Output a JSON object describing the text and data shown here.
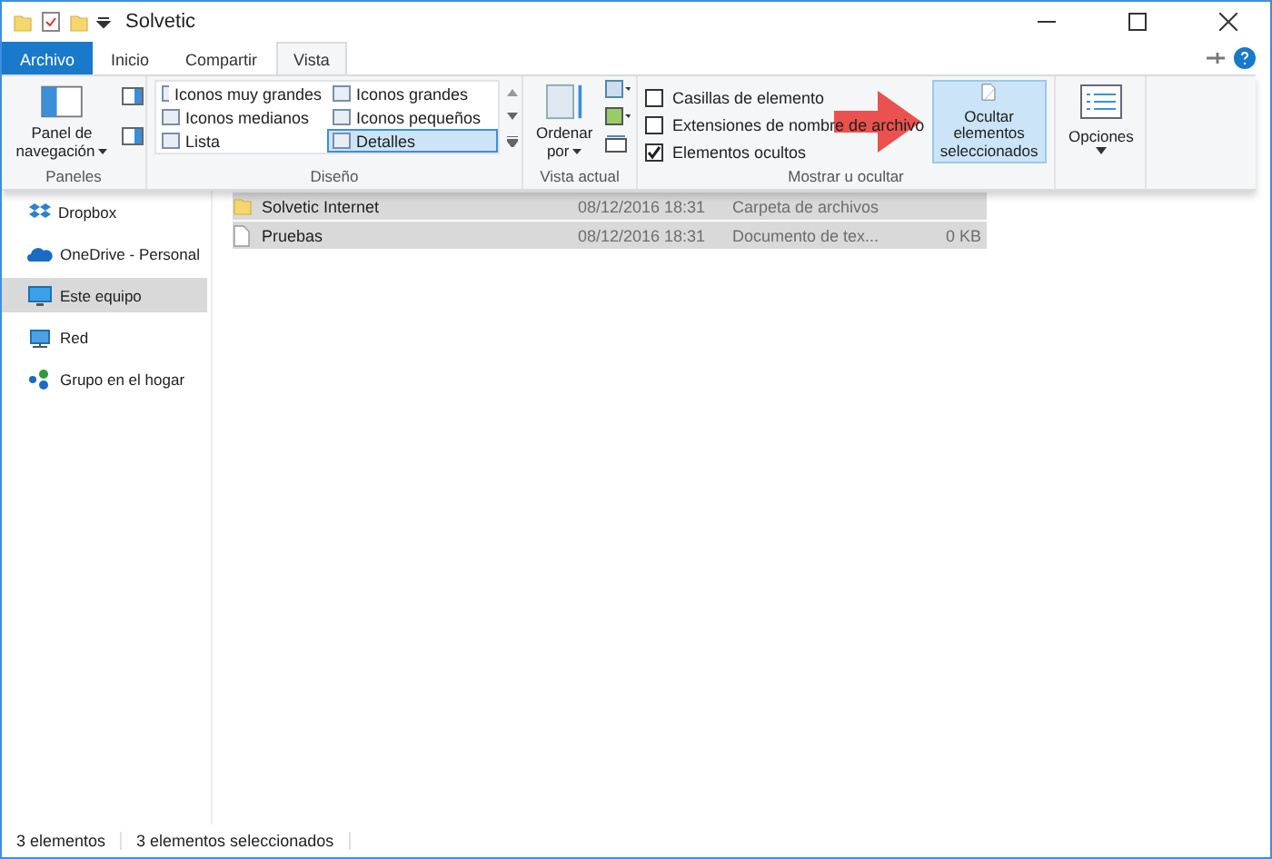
{
  "window": {
    "title": "Solvetic"
  },
  "tabs": [
    {
      "label": "Archivo",
      "kind": "file",
      "selected": false
    },
    {
      "label": "Inicio",
      "kind": "tab",
      "selected": false
    },
    {
      "label": "Compartir",
      "kind": "tab",
      "selected": false
    },
    {
      "label": "Vista",
      "kind": "tab",
      "selected": true
    }
  ],
  "ribbon": {
    "panes": {
      "title": "Paneles",
      "nav_pane": "Panel de navegación"
    },
    "layout": {
      "title": "Diseño",
      "options": [
        {
          "label": "Iconos muy grandes",
          "selected": false
        },
        {
          "label": "Iconos grandes",
          "selected": false
        },
        {
          "label": "Iconos medianos",
          "selected": false
        },
        {
          "label": "Iconos pequeños",
          "selected": false
        },
        {
          "label": "Lista",
          "selected": false
        },
        {
          "label": "Detalles",
          "selected": true
        }
      ]
    },
    "current_view": {
      "title": "Vista actual",
      "sort": "Ordenar por"
    },
    "show_hide": {
      "title": "Mostrar u ocultar",
      "options": [
        {
          "label": "Casillas de elemento",
          "checked": false
        },
        {
          "label": "Extensiones de nombre de archivo",
          "checked": false
        },
        {
          "label": "Elementos ocultos",
          "checked": true
        }
      ],
      "hide_button": "Ocultar elementos seleccionados"
    },
    "options": "Opciones"
  },
  "sidebar": {
    "items": [
      {
        "label": "Dropbox",
        "kind": "dropbox",
        "selected": false
      },
      {
        "label": "OneDrive - Personal",
        "kind": "cloud",
        "selected": false
      },
      {
        "label": "Este equipo",
        "kind": "pc",
        "selected": true
      },
      {
        "label": "Red",
        "kind": "network",
        "selected": false
      },
      {
        "label": "Grupo en el hogar",
        "kind": "home",
        "selected": false
      }
    ]
  },
  "files": [
    {
      "name": "Solvetic Internet",
      "date": "08/12/2016 18:31",
      "type": "Carpeta de archivos",
      "kind": "folder",
      "selected": true
    },
    {
      "name": "Pruebas",
      "date": "08/12/2016 18:31",
      "type": "Documento de tex...",
      "size": "0 KB",
      "kind": "file",
      "selected": true
    }
  ],
  "status_bar": [
    "3 elementos",
    "3 elementos seleccionados"
  ]
}
